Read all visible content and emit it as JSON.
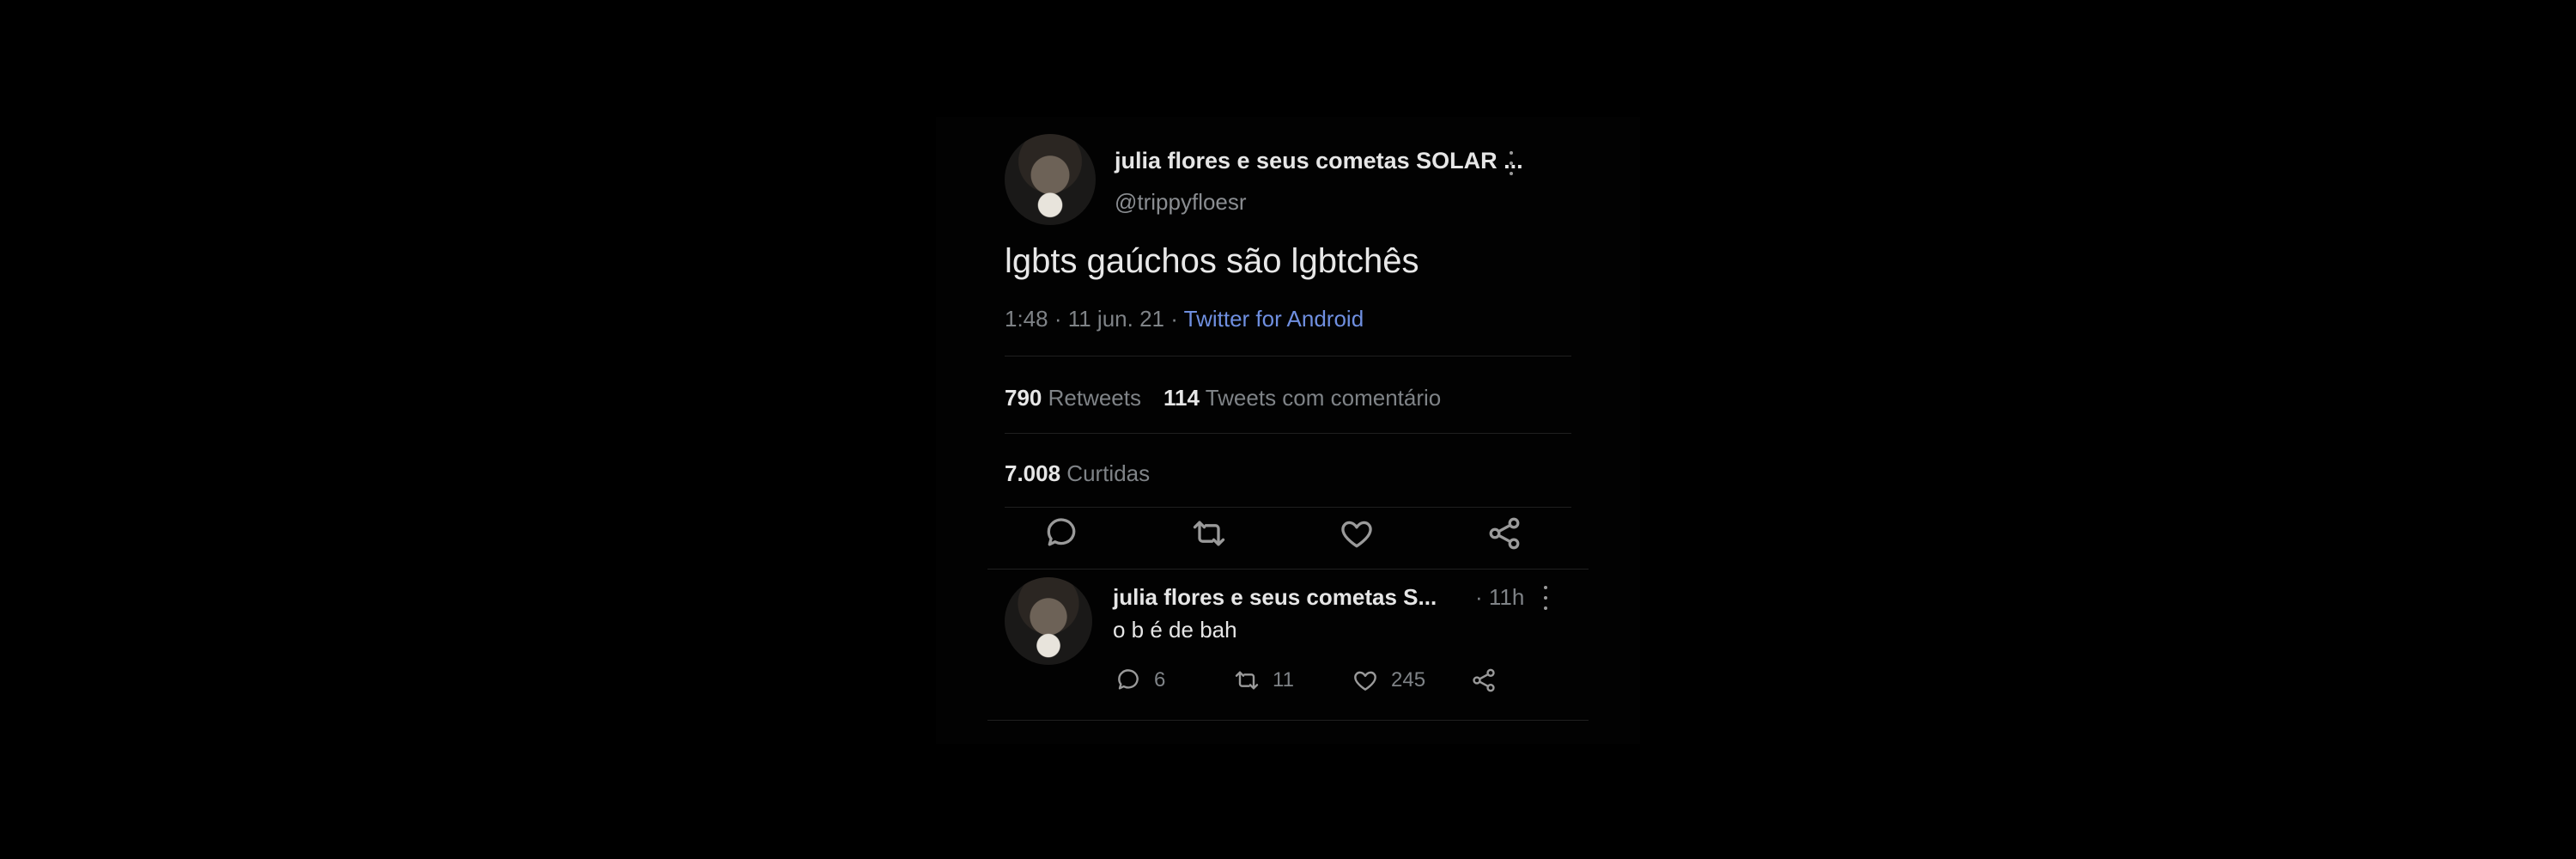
{
  "tweet": {
    "author": "julia flores e seus cometas SOLAR ...",
    "handle": "@trippyfloesr",
    "text": "lgbts gaúchos são lgbtchês",
    "time": "1:48 · 11 jun. 21 · ",
    "source": "Twitter for Android",
    "retweets_count": "790",
    "retweets_label": " Retweets",
    "quotes_count": "114",
    "quotes_label": " Tweets com comentário",
    "likes_count": "7.008",
    "likes_label": " Curtidas"
  },
  "reply": {
    "author": "julia flores e seus cometas S...",
    "time": "· 11h",
    "text": "o b é de bah",
    "replies": "6",
    "retweets": "11",
    "likes": "245"
  },
  "colors": {
    "background": "#000000",
    "link": "#6f8fe0",
    "muted": "#7f8387"
  },
  "icons": [
    "more-vertical-icon",
    "reply-icon",
    "retweet-icon",
    "like-icon",
    "share-icon"
  ]
}
